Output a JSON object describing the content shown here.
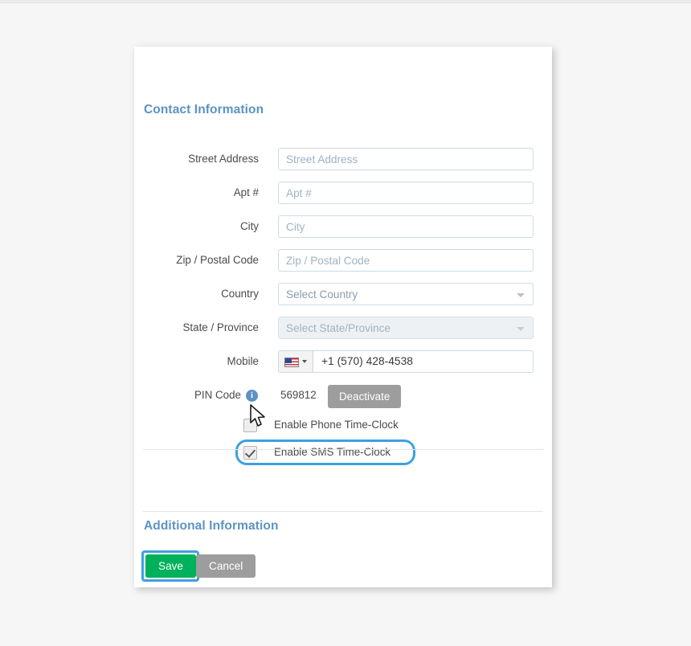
{
  "card": {
    "sections": {
      "contact_title": "Contact Information",
      "additional_title": "Additional Information"
    },
    "fields": [
      {
        "label": "Street Address",
        "placeholder": "Street Address",
        "value": "",
        "type": "text"
      },
      {
        "label": "Apt #",
        "placeholder": "Apt #",
        "value": "",
        "type": "text"
      },
      {
        "label": "City",
        "placeholder": "City",
        "value": "",
        "type": "text"
      },
      {
        "label": "Zip / Postal Code",
        "placeholder": "Zip / Postal Code",
        "value": "",
        "type": "text"
      }
    ],
    "selects": [
      {
        "label": "Country",
        "value": "Select Country",
        "disabled": false
      },
      {
        "label": "State / Province",
        "value": "Select State/Province",
        "disabled": true
      }
    ],
    "mobile": {
      "label": "Mobile",
      "country_flag": "us-flag-icon",
      "value": "+1 (570) 428-4538"
    },
    "pin": {
      "label": "PIN Code",
      "info_glyph": "i",
      "value": "569812",
      "button_label": "Deactivate"
    },
    "checkboxes": [
      {
        "label": "Enable Phone Time-Clock",
        "checked": false,
        "highlighted": false
      },
      {
        "label": "Enable SMS Time-Clock",
        "checked": true,
        "highlighted": true
      }
    ],
    "footer": {
      "save_label": "Save",
      "cancel_label": "Cancel"
    }
  },
  "colors": {
    "section_title": "#5b93c4",
    "save_green": "#00b15c",
    "neutral_gray": "#9d9d9d",
    "highlight_blue": "#3fa0e0",
    "field_border": "#cbdbe6",
    "page_bg": "#f6f6f6"
  }
}
